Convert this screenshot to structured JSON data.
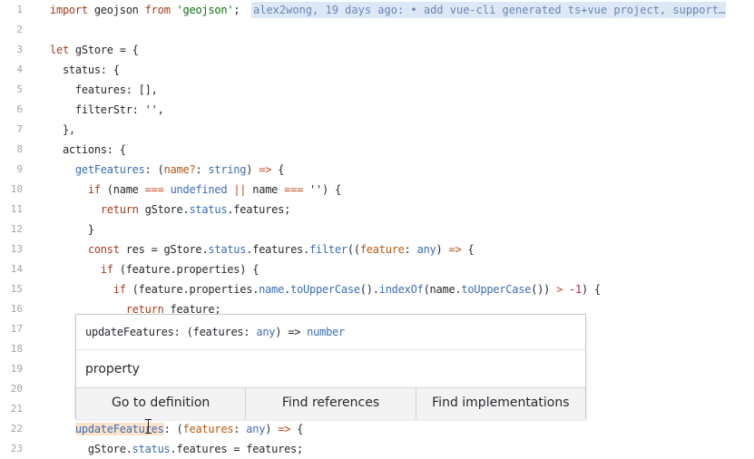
{
  "editor": {
    "lines": [
      {
        "num": "1",
        "tokens": [
          {
            "t": "import",
            "c": "kw"
          },
          {
            "t": " geojson ",
            "c": "t"
          },
          {
            "t": "from",
            "c": "kw"
          },
          {
            "t": " ",
            "c": "t"
          },
          {
            "t": "'geojson'",
            "c": "st"
          },
          {
            "t": ";",
            "c": "t"
          }
        ]
      },
      {
        "num": "2",
        "tokens": []
      },
      {
        "num": "3",
        "tokens": [
          {
            "t": "let",
            "c": "kw"
          },
          {
            "t": " gStore = {",
            "c": "t"
          }
        ]
      },
      {
        "num": "4",
        "tokens": [
          {
            "t": "  status: {",
            "c": "t"
          }
        ]
      },
      {
        "num": "5",
        "tokens": [
          {
            "t": "    features: [],",
            "c": "t"
          }
        ]
      },
      {
        "num": "6",
        "tokens": [
          {
            "t": "    filterStr: '',",
            "c": "t"
          }
        ]
      },
      {
        "num": "7",
        "tokens": [
          {
            "t": "  },",
            "c": "t"
          }
        ]
      },
      {
        "num": "8",
        "tokens": [
          {
            "t": "  actions: {",
            "c": "t"
          }
        ]
      },
      {
        "num": "9",
        "tokens": [
          {
            "t": "    ",
            "c": "t"
          },
          {
            "t": "getFeatures",
            "c": "fn"
          },
          {
            "t": ": (",
            "c": "t"
          },
          {
            "t": "name?",
            "c": "pa"
          },
          {
            "t": ": ",
            "c": "t"
          },
          {
            "t": "string",
            "c": "ty"
          },
          {
            "t": ") ",
            "c": "t"
          },
          {
            "t": "=>",
            "c": "ar"
          },
          {
            "t": " {",
            "c": "t"
          }
        ]
      },
      {
        "num": "10",
        "tokens": [
          {
            "t": "      ",
            "c": "t"
          },
          {
            "t": "if",
            "c": "kw"
          },
          {
            "t": " (name ",
            "c": "t"
          },
          {
            "t": "===",
            "c": "ar"
          },
          {
            "t": " ",
            "c": "t"
          },
          {
            "t": "undefined",
            "c": "pr"
          },
          {
            "t": " ",
            "c": "t"
          },
          {
            "t": "||",
            "c": "ar"
          },
          {
            "t": " name ",
            "c": "t"
          },
          {
            "t": "===",
            "c": "ar"
          },
          {
            "t": " '') {",
            "c": "t"
          }
        ]
      },
      {
        "num": "11",
        "tokens": [
          {
            "t": "        ",
            "c": "t"
          },
          {
            "t": "return",
            "c": "kw"
          },
          {
            "t": " gStore.",
            "c": "t"
          },
          {
            "t": "status",
            "c": "pr"
          },
          {
            "t": ".features;",
            "c": "t"
          }
        ]
      },
      {
        "num": "12",
        "tokens": [
          {
            "t": "      }",
            "c": "t"
          }
        ]
      },
      {
        "num": "13",
        "tokens": [
          {
            "t": "      ",
            "c": "t"
          },
          {
            "t": "const",
            "c": "kw"
          },
          {
            "t": " res = gStore.",
            "c": "t"
          },
          {
            "t": "status",
            "c": "pr"
          },
          {
            "t": ".features.",
            "c": "t"
          },
          {
            "t": "filter",
            "c": "fn"
          },
          {
            "t": "((",
            "c": "t"
          },
          {
            "t": "feature",
            "c": "pa"
          },
          {
            "t": ": ",
            "c": "t"
          },
          {
            "t": "any",
            "c": "ty"
          },
          {
            "t": ") ",
            "c": "t"
          },
          {
            "t": "=>",
            "c": "ar"
          },
          {
            "t": " {",
            "c": "t"
          }
        ]
      },
      {
        "num": "14",
        "tokens": [
          {
            "t": "        ",
            "c": "t"
          },
          {
            "t": "if",
            "c": "kw"
          },
          {
            "t": " (feature.properties) {",
            "c": "t"
          }
        ]
      },
      {
        "num": "15",
        "tokens": [
          {
            "t": "          ",
            "c": "t"
          },
          {
            "t": "if",
            "c": "kw"
          },
          {
            "t": " (feature.properties.",
            "c": "t"
          },
          {
            "t": "name",
            "c": "pr"
          },
          {
            "t": ".",
            "c": "t"
          },
          {
            "t": "toUpperCase",
            "c": "fn"
          },
          {
            "t": "().",
            "c": "t"
          },
          {
            "t": "indexOf",
            "c": "fn"
          },
          {
            "t": "(name.",
            "c": "t"
          },
          {
            "t": "toUpperCase",
            "c": "fn"
          },
          {
            "t": "()) ",
            "c": "t"
          },
          {
            "t": ">",
            "c": "ar"
          },
          {
            "t": " ",
            "c": "t"
          },
          {
            "t": "-1",
            "c": "mt"
          },
          {
            "t": ") {",
            "c": "t"
          }
        ]
      },
      {
        "num": "16",
        "tokens": [
          {
            "t": "            ",
            "c": "t"
          },
          {
            "t": "return",
            "c": "kw"
          },
          {
            "t": " feature;",
            "c": "t"
          }
        ]
      },
      {
        "num": "17",
        "tokens": []
      },
      {
        "num": "18",
        "tokens": []
      },
      {
        "num": "19",
        "tokens": []
      },
      {
        "num": "20",
        "tokens": []
      },
      {
        "num": "21",
        "tokens": []
      },
      {
        "num": "22",
        "tokens": [
          {
            "t": "    ",
            "c": "t"
          },
          {
            "t": "updateFeatures",
            "c": "fn",
            "hl": true
          },
          {
            "t": ": (",
            "c": "t"
          },
          {
            "t": "features",
            "c": "pa"
          },
          {
            "t": ": ",
            "c": "t"
          },
          {
            "t": "any",
            "c": "ty"
          },
          {
            "t": ") ",
            "c": "t"
          },
          {
            "t": "=>",
            "c": "ar"
          },
          {
            "t": " {",
            "c": "t"
          }
        ]
      },
      {
        "num": "23",
        "tokens": [
          {
            "t": "      gStore.",
            "c": "t"
          },
          {
            "t": "status",
            "c": "pr"
          },
          {
            "t": ".features = features;",
            "c": "t"
          }
        ]
      }
    ],
    "blame": "alex2wong, 19 days ago: • add vue-cli generated ts+vue project, support…"
  },
  "hover": {
    "signature": [
      {
        "t": "updateFeatures",
        "c": "t"
      },
      {
        "t": ": (",
        "c": "t"
      },
      {
        "t": "features",
        "c": "t"
      },
      {
        "t": ": ",
        "c": "t"
      },
      {
        "t": "any",
        "c": "ty"
      },
      {
        "t": ") ",
        "c": "t"
      },
      {
        "t": "=>",
        "c": "t"
      },
      {
        "t": " ",
        "c": "t"
      },
      {
        "t": "number",
        "c": "ty"
      }
    ],
    "kind": "property",
    "actions": {
      "definition": "Go to definition",
      "references": "Find references",
      "implementations": "Find implementations"
    }
  }
}
